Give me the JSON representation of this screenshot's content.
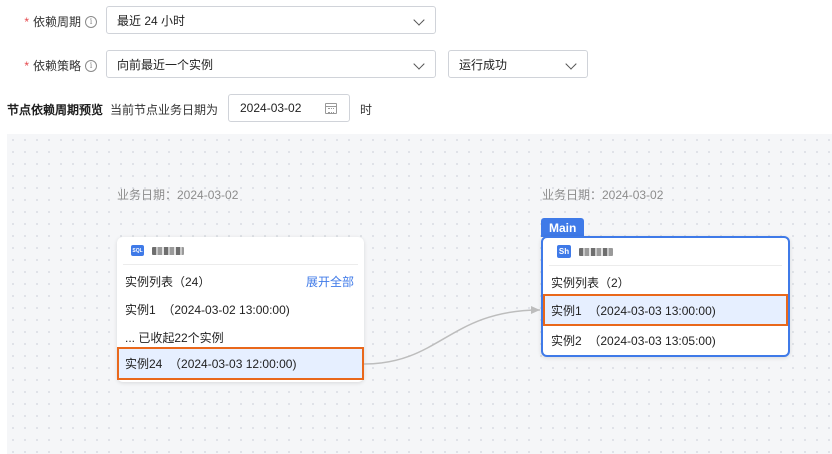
{
  "form": {
    "cycle": {
      "required_mark": "*",
      "label": "依赖周期",
      "info_icon": "i",
      "value": "最近 24 小时"
    },
    "strategy": {
      "required_mark": "*",
      "label": "依赖策略",
      "info_icon": "i",
      "value": "向前最近一个实例",
      "status_value": "运行成功"
    }
  },
  "preview": {
    "title": "节点依赖周期预览",
    "subtitle": "当前节点业务日期为",
    "date_value": "2024-03-02",
    "suffix": "时"
  },
  "upstream": {
    "biz_date": "业务日期：2024-03-02",
    "type_badge": "SQL",
    "list_title": "实例列表（24）",
    "expand_all": "展开全部",
    "rows": [
      "实例1  （2024-03-02 13:00:00)",
      "... 已收起22个实例",
      "实例24  （2024-03-03 12:00:00)"
    ]
  },
  "current": {
    "biz_date": "业务日期：2024-03-02",
    "main_tag": "Main",
    "type_badge": "Sh",
    "list_title": "实例列表（2）",
    "rows": [
      "实例1  （2024-03-03 13:00:00)",
      "实例2  （2024-03-03 13:05:00)"
    ]
  },
  "colors": {
    "accent": "#3f7ae8",
    "highlight_border": "#e9681b",
    "highlight_fill": "#e6efff",
    "required": "#e5484d"
  }
}
